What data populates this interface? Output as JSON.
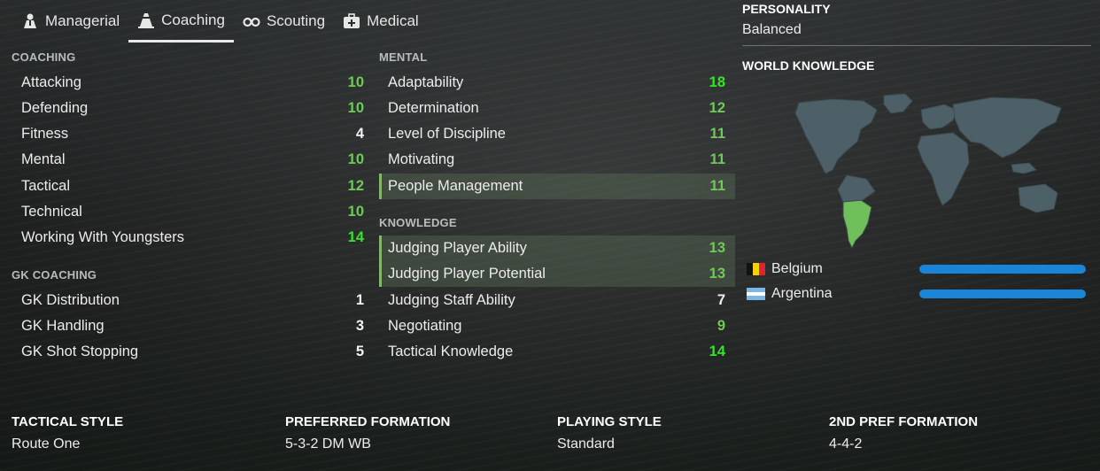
{
  "tabs": [
    {
      "label": "Managerial",
      "icon": "person-icon"
    },
    {
      "label": "Coaching",
      "icon": "cone-icon",
      "active": true
    },
    {
      "label": "Scouting",
      "icon": "binoculars-icon"
    },
    {
      "label": "Medical",
      "icon": "medical-kit-icon"
    }
  ],
  "coaching": {
    "title": "COACHING",
    "rows": [
      {
        "label": "Attacking",
        "value": "10"
      },
      {
        "label": "Defending",
        "value": "10"
      },
      {
        "label": "Fitness",
        "value": "4"
      },
      {
        "label": "Mental",
        "value": "10"
      },
      {
        "label": "Tactical",
        "value": "12"
      },
      {
        "label": "Technical",
        "value": "10"
      },
      {
        "label": "Working With Youngsters",
        "value": "14"
      }
    ]
  },
  "gk_coaching": {
    "title": "GK COACHING",
    "rows": [
      {
        "label": "GK Distribution",
        "value": "1"
      },
      {
        "label": "GK Handling",
        "value": "3"
      },
      {
        "label": "GK Shot Stopping",
        "value": "5"
      }
    ]
  },
  "mental": {
    "title": "MENTAL",
    "rows": [
      {
        "label": "Adaptability",
        "value": "18"
      },
      {
        "label": "Determination",
        "value": "12"
      },
      {
        "label": "Level of Discipline",
        "value": "11"
      },
      {
        "label": "Motivating",
        "value": "11"
      },
      {
        "label": "People Management",
        "value": "11",
        "highlighted": true
      }
    ]
  },
  "knowledge": {
    "title": "KNOWLEDGE",
    "rows": [
      {
        "label": "Judging Player Ability",
        "value": "13",
        "highlighted": true
      },
      {
        "label": "Judging Player Potential",
        "value": "13",
        "highlighted": true
      },
      {
        "label": "Judging Staff Ability",
        "value": "7"
      },
      {
        "label": "Negotiating",
        "value": "9"
      },
      {
        "label": "Tactical Knowledge",
        "value": "14"
      }
    ]
  },
  "personality": {
    "title": "PERSONALITY",
    "value": "Balanced"
  },
  "world_knowledge": {
    "title": "WORLD KNOWLEDGE",
    "countries": [
      {
        "name": "Belgium",
        "knowledge": 1.0
      },
      {
        "name": "Argentina",
        "knowledge": 1.0
      }
    ]
  },
  "footer": {
    "tactical_style": {
      "label": "TACTICAL STYLE",
      "value": "Route One"
    },
    "preferred_formation": {
      "label": "PREFERRED FORMATION",
      "value": "5-3-2 DM WB"
    },
    "playing_style": {
      "label": "PLAYING STYLE",
      "value": "Standard"
    },
    "second_formation": {
      "label": "2ND PREF FORMATION",
      "value": "4-4-2"
    }
  },
  "colors": {
    "highlight_bg": "#4b5a47",
    "green_value": "#6fca58",
    "bright_green_value": "#38e32c",
    "knowledge_bar": "#1a85d6",
    "map_land": "#4d6068",
    "map_highlight": "#6fbf5a"
  }
}
